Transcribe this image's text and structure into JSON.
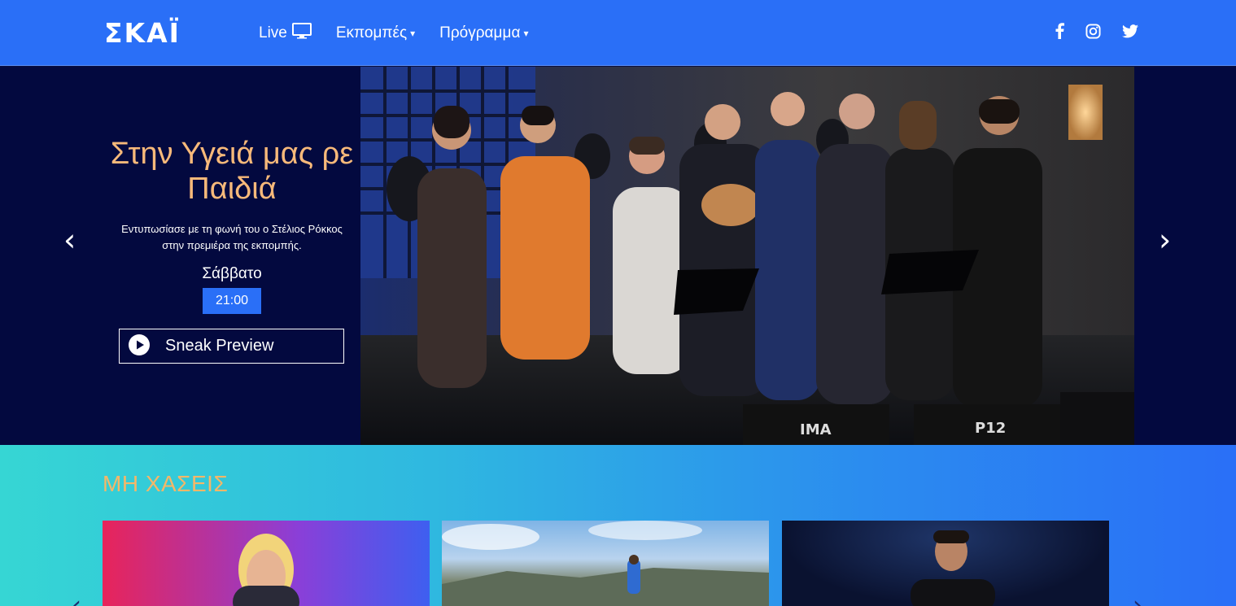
{
  "header": {
    "logo": "ΣΚΑΪ",
    "nav": [
      {
        "label": "Live",
        "icon": "tv-icon"
      },
      {
        "label": "Εκπομπές",
        "icon": "caret-down-icon"
      },
      {
        "label": "Πρόγραμμα",
        "icon": "caret-down-icon"
      }
    ],
    "social": [
      "facebook-icon",
      "instagram-icon",
      "twitter-icon"
    ]
  },
  "hero": {
    "title": "Στην Υγειά μας ρε Παιδιά",
    "description": "Εντυπωσίασε με τη φωνή του ο Στέλιος Ρόκκος στην πρεμιέρα της εκπομπής.",
    "day": "Σάββατο",
    "time": "21:00",
    "button_label": "Sneak Preview",
    "speaker_labels": [
      "IMA",
      "P12"
    ]
  },
  "section": {
    "title": "ΜΗ ΧΑΣΕΙΣ"
  },
  "colors": {
    "header_bg": "#2a6ff7",
    "hero_bg": "#03093f",
    "title_accent": "#f7b97a",
    "time_badge": "#2a6ff7",
    "section_title": "#f4b768"
  }
}
